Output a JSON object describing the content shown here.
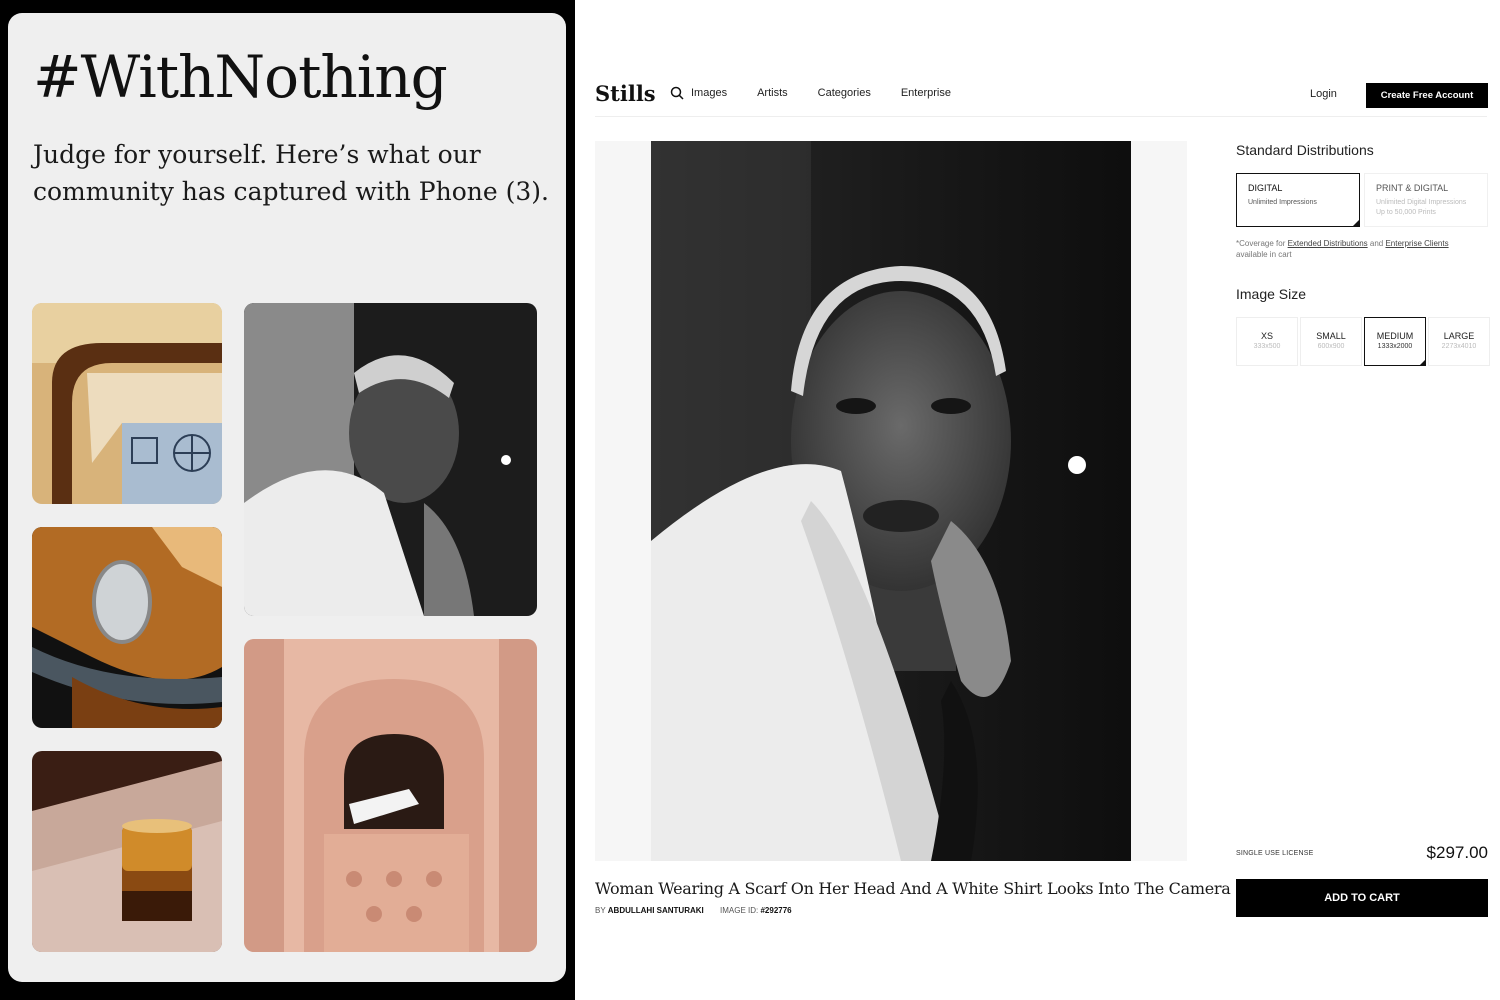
{
  "promo": {
    "headline": "#WithNothing",
    "subtitle": "Judge for yourself. Here’s what our community has captured with Phone (3)."
  },
  "store": {
    "logo": "Stills",
    "nav": [
      "Images",
      "Artists",
      "Categories",
      "Enterprise"
    ],
    "login": "Login",
    "cta": "Create Free Account",
    "image": {
      "title": "Woman Wearing A Scarf On Her Head And A White Shirt Looks Into The Camera",
      "by_label": "BY",
      "author": "ABDULLAHI SANTURAKI",
      "id_label": "IMAGE ID:",
      "id": "#292776"
    },
    "distributions": {
      "title": "Standard Distributions",
      "options": [
        {
          "name": "DIGITAL",
          "desc": "Unlimited Impressions",
          "desc2": ""
        },
        {
          "name": "PRINT & DIGITAL",
          "desc": "Unlimited Digital Impressions",
          "desc2": "Up to 50,000 Prints"
        }
      ],
      "coverage_prefix": "*Coverage for",
      "coverage_link1": "Extended Distributions",
      "coverage_and": "and",
      "coverage_link2": "Enterprise Clients",
      "coverage_suffix": "available in cart"
    },
    "sizes": {
      "title": "Image Size",
      "options": [
        {
          "name": "XS",
          "dims": "333x500"
        },
        {
          "name": "SMALL",
          "dims": "600x900"
        },
        {
          "name": "MEDIUM",
          "dims": "1333x2000"
        },
        {
          "name": "LARGE",
          "dims": "2273x4010"
        }
      ]
    },
    "license": "SINGLE USE LICENSE",
    "price": "$297.00",
    "add_to_cart": "ADD TO CART"
  }
}
